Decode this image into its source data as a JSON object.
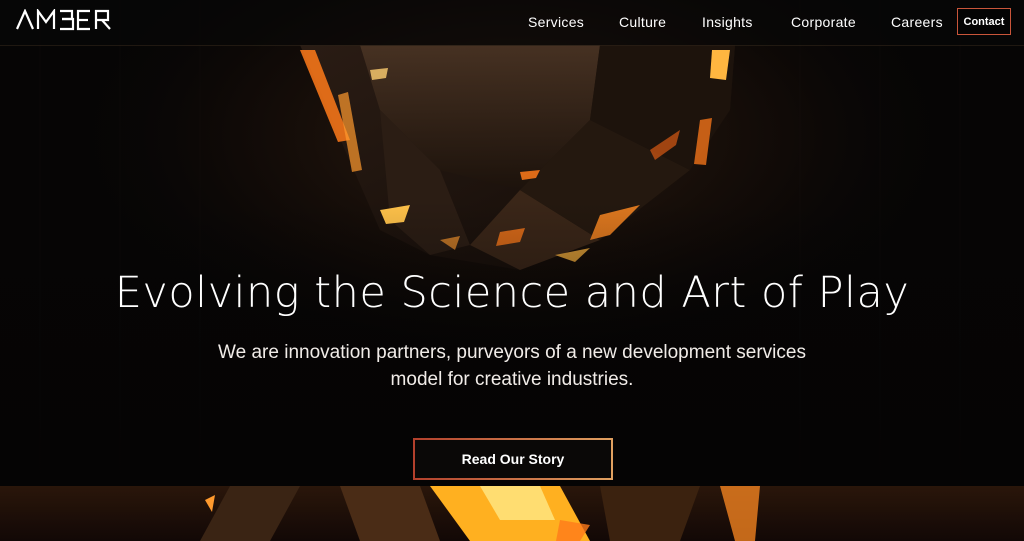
{
  "brand": {
    "logo_text": "AMBER"
  },
  "nav": {
    "items": [
      {
        "label": "Services"
      },
      {
        "label": "Culture"
      },
      {
        "label": "Insights"
      },
      {
        "label": "Corporate"
      },
      {
        "label": "Careers"
      }
    ],
    "contact_label": "Contact"
  },
  "hero": {
    "headline": "Evolving the Science and Art of Play",
    "subtitle": "We are innovation partners, purveyors of a new development services model for creative industries.",
    "cta_label": "Read Our Story"
  },
  "colors": {
    "background": "#060505",
    "accent_orange": "#f08a2a",
    "accent_red": "#c9553a",
    "text": "#ffffff"
  }
}
